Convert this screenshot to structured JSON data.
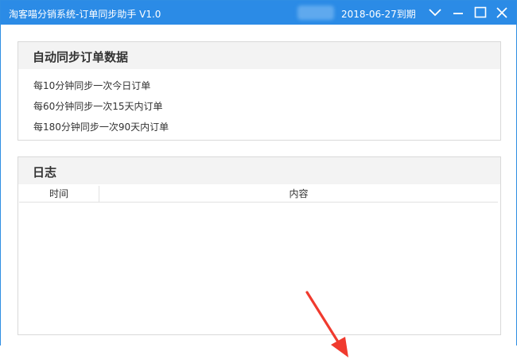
{
  "window": {
    "title": "淘客喵分销系统-订单同步助手 V1.0",
    "expiry": "2018-06-27到期",
    "controls": [
      "chevron-down-icon",
      "minimize-icon",
      "maximize-icon",
      "close-icon"
    ],
    "accent_color": "#2b8be6"
  },
  "sync_panel": {
    "title": "自动同步订单数据",
    "lines": [
      "每10分钟同步一次今日订单",
      "每60分钟同步一次15天内订单",
      "每180分钟同步一次90天内订单"
    ]
  },
  "log_panel": {
    "title": "日志",
    "columns": [
      "时间",
      "内容"
    ],
    "rows": []
  },
  "annotation": {
    "icon": "red-arrow-icon",
    "color": "#f03a2e"
  }
}
